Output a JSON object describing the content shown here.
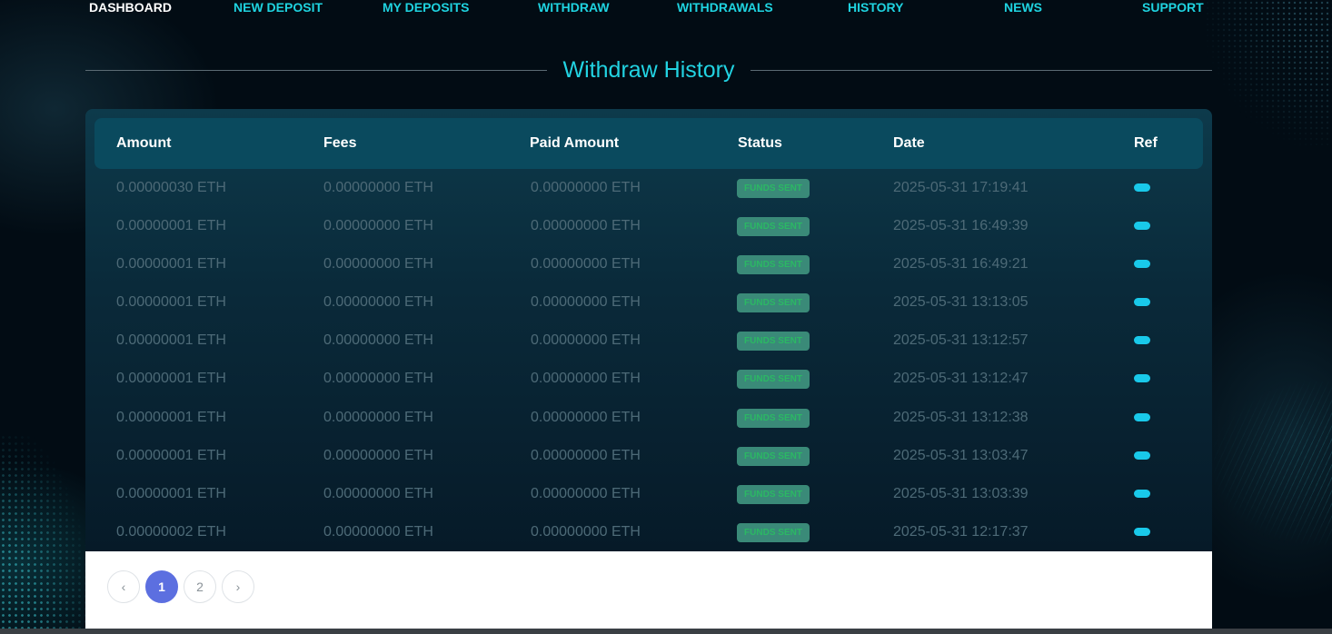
{
  "nav": {
    "items": [
      {
        "label": "DASHBOARD",
        "active": true
      },
      {
        "label": "NEW DEPOSIT",
        "active": false
      },
      {
        "label": "MY DEPOSITS",
        "active": false
      },
      {
        "label": "WITHDRAW",
        "active": false
      },
      {
        "label": "WITHDRAWALS",
        "active": false
      },
      {
        "label": "HISTORY",
        "active": false
      },
      {
        "label": "NEWS",
        "active": false
      },
      {
        "label": "SUPPORT",
        "active": false
      }
    ]
  },
  "page": {
    "title": "Withdraw History"
  },
  "table": {
    "headers": {
      "amount": "Amount",
      "fees": "Fees",
      "paid": "Paid Amount",
      "status": "Status",
      "date": "Date",
      "ref": "Ref"
    },
    "rows": [
      {
        "amount": "0.00000030 ETH",
        "fees": "0.00000000 ETH",
        "paid": "0.00000000 ETH",
        "status": "FUNDS SENT",
        "date": "2025-05-31 17:19:41"
      },
      {
        "amount": "0.00000001 ETH",
        "fees": "0.00000000 ETH",
        "paid": "0.00000000 ETH",
        "status": "FUNDS SENT",
        "date": "2025-05-31 16:49:39"
      },
      {
        "amount": "0.00000001 ETH",
        "fees": "0.00000000 ETH",
        "paid": "0.00000000 ETH",
        "status": "FUNDS SENT",
        "date": "2025-05-31 16:49:21"
      },
      {
        "amount": "0.00000001 ETH",
        "fees": "0.00000000 ETH",
        "paid": "0.00000000 ETH",
        "status": "FUNDS SENT",
        "date": "2025-05-31 13:13:05"
      },
      {
        "amount": "0.00000001 ETH",
        "fees": "0.00000000 ETH",
        "paid": "0.00000000 ETH",
        "status": "FUNDS SENT",
        "date": "2025-05-31 13:12:57"
      },
      {
        "amount": "0.00000001 ETH",
        "fees": "0.00000000 ETH",
        "paid": "0.00000000 ETH",
        "status": "FUNDS SENT",
        "date": "2025-05-31 13:12:47"
      },
      {
        "amount": "0.00000001 ETH",
        "fees": "0.00000000 ETH",
        "paid": "0.00000000 ETH",
        "status": "FUNDS SENT",
        "date": "2025-05-31 13:12:38"
      },
      {
        "amount": "0.00000001 ETH",
        "fees": "0.00000000 ETH",
        "paid": "0.00000000 ETH",
        "status": "FUNDS SENT",
        "date": "2025-05-31 13:03:47"
      },
      {
        "amount": "0.00000001 ETH",
        "fees": "0.00000000 ETH",
        "paid": "0.00000000 ETH",
        "status": "FUNDS SENT",
        "date": "2025-05-31 13:03:39"
      },
      {
        "amount": "0.00000002 ETH",
        "fees": "0.00000000 ETH",
        "paid": "0.00000000 ETH",
        "status": "FUNDS SENT",
        "date": "2025-05-31 12:17:37"
      }
    ]
  },
  "pagination": {
    "prev": "‹",
    "pages": [
      "1",
      "2"
    ],
    "current": "1",
    "next": "›"
  },
  "colors": {
    "accent": "#1fd3e0",
    "status_badge_bg": "#3a8a78",
    "status_badge_text": "#2bb864",
    "ref_pill": "#19c9ea",
    "page_active": "#5c6fe0"
  },
  "icons": {
    "prev": "chevron-left-icon",
    "next": "chevron-right-icon",
    "ref": "reference-pill-icon"
  }
}
